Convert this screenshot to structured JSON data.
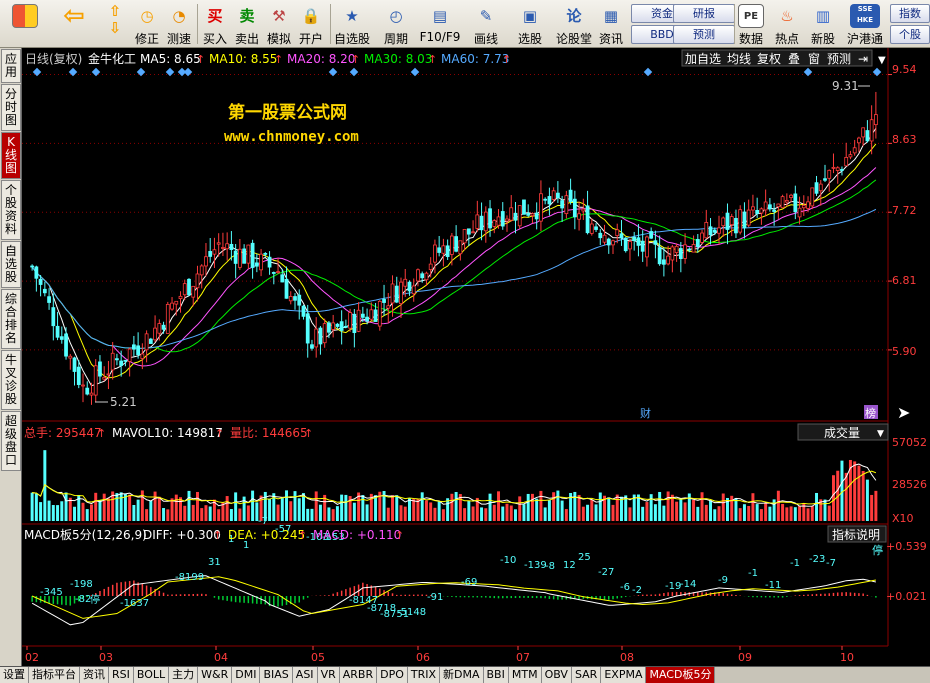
{
  "toolbar": {
    "buttons": [
      {
        "name": "fwd",
        "label": ""
      },
      {
        "name": "correct",
        "label": "修正"
      },
      {
        "name": "quick",
        "label": "测速"
      },
      {
        "name": "buy",
        "label": "买入",
        "icon": "买"
      },
      {
        "name": "sell",
        "label": "卖出",
        "icon": "卖"
      },
      {
        "name": "simulate",
        "label": "模拟"
      },
      {
        "name": "account",
        "label": "开户"
      },
      {
        "name": "watchlist",
        "label": "自选股"
      },
      {
        "name": "period",
        "label": "周期"
      },
      {
        "name": "f10",
        "label": "F10/F9"
      },
      {
        "name": "draw",
        "label": "画线"
      },
      {
        "name": "select",
        "label": "选股"
      },
      {
        "name": "forum",
        "label": "论股堂",
        "icon": "论"
      },
      {
        "name": "info",
        "label": "资讯"
      },
      {
        "name": "data",
        "label": "数据",
        "icon": "PE"
      },
      {
        "name": "hot",
        "label": "热点"
      },
      {
        "name": "ipo",
        "label": "新股"
      },
      {
        "name": "hk",
        "label": "沪港通",
        "icon": "SSE HKE"
      }
    ],
    "small": {
      "fund": "资金",
      "bbd": "BBD",
      "research": "研报",
      "forecast": "预测",
      "index": "指数",
      "stock": "个股"
    }
  },
  "leftnav": [
    "应用",
    "分时图",
    "K线图",
    "个股资料",
    "自选股",
    "综合排名",
    "牛叉诊股",
    "超级盘口"
  ],
  "header": {
    "period": "日线(复权)",
    "stock": "金牛化工",
    "ma": [
      {
        "t": "MA5: 8.65",
        "c": "#ffffff"
      },
      {
        "t": "MA10: 8.55",
        "c": "#ffff00"
      },
      {
        "t": "MA20: 8.20",
        "c": "#ff55ff"
      },
      {
        "t": "MA30: 8.03",
        "c": "#00ee00"
      },
      {
        "t": "MA60: 7.73",
        "c": "#55aaff"
      }
    ],
    "buttons": [
      "加自选",
      "均线",
      "复权",
      "叠",
      "窗",
      "预测"
    ]
  },
  "watermark": {
    "line1": "第一股票公式网",
    "line2": "www.chnmoney.com"
  },
  "price_labels": {
    "high": "9.31",
    "low": "5.21",
    "cai": "财",
    "bang": "榜"
  },
  "volume": {
    "total": "总手: 295447",
    "mavol": "MAVOL10: 149817",
    "ratio": "量比: 144665",
    "button": "成交量",
    "unit": "X10"
  },
  "macd": {
    "title": "MACD板5分(12,26,9)",
    "diff": "DIFF: +0.300",
    "dea": "DEA: +0.245",
    "macd": "MACD: +0.110",
    "button": "指标说明",
    "stop": "停",
    "annots": [
      {
        "x": 40,
        "y": 595,
        "t": "-345"
      },
      {
        "x": 70,
        "y": 587,
        "t": "-198"
      },
      {
        "x": 75,
        "y": 602,
        "t": "-82"
      },
      {
        "x": 90,
        "y": 603,
        "t": "停"
      },
      {
        "x": 120,
        "y": 606,
        "t": "-1637"
      },
      {
        "x": 175,
        "y": 580,
        "t": "-8199"
      },
      {
        "x": 208,
        "y": 565,
        "t": "31"
      },
      {
        "x": 228,
        "y": 542,
        "t": "1"
      },
      {
        "x": 243,
        "y": 548,
        "t": "1"
      },
      {
        "x": 258,
        "y": 524,
        "t": "-7"
      },
      {
        "x": 275,
        "y": 532,
        "t": "-57"
      },
      {
        "x": 306,
        "y": 540,
        "t": "-103"
      },
      {
        "x": 322,
        "y": 540,
        "t": "-153"
      },
      {
        "x": 349,
        "y": 603,
        "t": "-8147"
      },
      {
        "x": 367,
        "y": 611,
        "t": "-8718"
      },
      {
        "x": 380,
        "y": 617,
        "t": "-8751"
      },
      {
        "x": 397,
        "y": 615,
        "t": "-5148"
      },
      {
        "x": 427,
        "y": 600,
        "t": "-91"
      },
      {
        "x": 461,
        "y": 585,
        "t": "-69"
      },
      {
        "x": 500,
        "y": 563,
        "t": "-10"
      },
      {
        "x": 524,
        "y": 568,
        "t": "-139"
      },
      {
        "x": 545,
        "y": 569,
        "t": "-8"
      },
      {
        "x": 563,
        "y": 568,
        "t": "12"
      },
      {
        "x": 578,
        "y": 560,
        "t": "25"
      },
      {
        "x": 598,
        "y": 575,
        "t": "-27"
      },
      {
        "x": 620,
        "y": 590,
        "t": "-6"
      },
      {
        "x": 632,
        "y": 593,
        "t": "-2"
      },
      {
        "x": 665,
        "y": 589,
        "t": "-19"
      },
      {
        "x": 680,
        "y": 587,
        "t": "-14"
      },
      {
        "x": 718,
        "y": 583,
        "t": "-9"
      },
      {
        "x": 748,
        "y": 576,
        "t": "-1"
      },
      {
        "x": 765,
        "y": 588,
        "t": "-11"
      },
      {
        "x": 790,
        "y": 566,
        "t": "-1"
      },
      {
        "x": 809,
        "y": 562,
        "t": "-23"
      },
      {
        "x": 826,
        "y": 566,
        "t": "-7"
      }
    ]
  },
  "yaxis": {
    "price": [
      "9.54",
      "8.63",
      "7.72",
      "6.81",
      "5.90"
    ],
    "vol": [
      "57052",
      "28526"
    ],
    "macd": [
      "+0.539",
      "+0.021"
    ]
  },
  "months": [
    "02",
    "03",
    "04",
    "05",
    "06",
    "07",
    "08",
    "09",
    "10"
  ],
  "tabs": [
    "设置",
    "指标平台",
    "资讯",
    "RSI",
    "BOLL",
    "主力",
    "W&R",
    "DMI",
    "BIAS",
    "ASI",
    "VR",
    "ARBR",
    "DPO",
    "TRIX",
    "新DMA",
    "BBI",
    "MTM",
    "OBV",
    "SAR",
    "EXPMA",
    "MACD板5分"
  ],
  "colors": {
    "up": "#ff3c3c",
    "down": "#54ffff",
    "ma5": "#ffffff",
    "ma10": "#ffff00",
    "ma20": "#ff55ff",
    "ma30": "#00ee00",
    "ma60": "#55aaff",
    "grid": "#8b0000"
  },
  "chart_data": {
    "type": "candlestick",
    "ylim": [
      5.0,
      9.6
    ],
    "price_ticks": [
      9.54,
      8.63,
      7.72,
      6.81,
      5.9
    ],
    "waypoints": [
      [
        0,
        7.0
      ],
      [
        12,
        5.4
      ],
      [
        28,
        6.1
      ],
      [
        44,
        7.3
      ],
      [
        58,
        6.95
      ],
      [
        66,
        6.0
      ],
      [
        80,
        6.4
      ],
      [
        96,
        7.2
      ],
      [
        110,
        7.7
      ],
      [
        124,
        7.85
      ],
      [
        140,
        7.3
      ],
      [
        150,
        7.15
      ],
      [
        165,
        7.6
      ],
      [
        180,
        7.8
      ],
      [
        190,
        8.3
      ],
      [
        200,
        9.0
      ]
    ],
    "high": 9.31,
    "low": 5.21
  }
}
